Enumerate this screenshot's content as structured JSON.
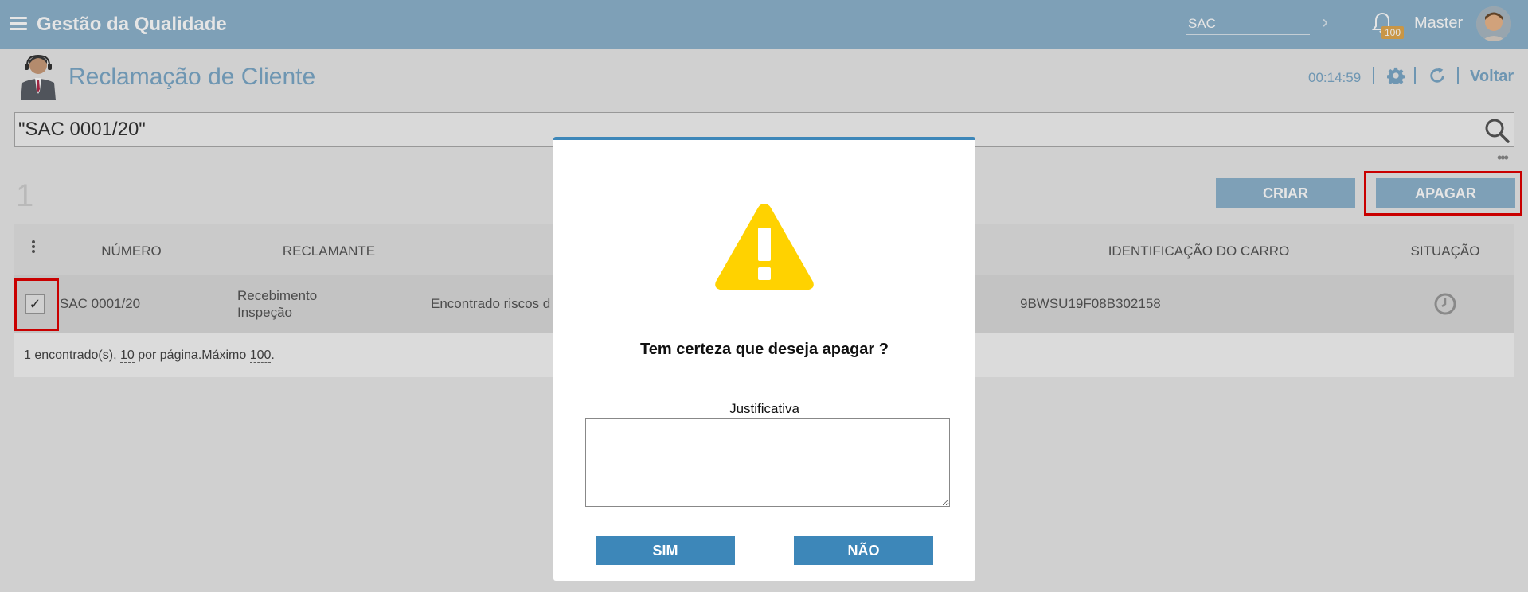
{
  "topbar": {
    "app_title": "Gestão da Qualidade",
    "sac_value": "SAC",
    "badge": "100",
    "user": "Master"
  },
  "header": {
    "title": "Reclamação de Cliente",
    "timer": "00:14:59",
    "voltar": "Voltar"
  },
  "search": {
    "value": "\"SAC 0001/20\""
  },
  "list": {
    "count": "1",
    "criar": "CRIAR",
    "apagar": "APAGAR",
    "columns": {
      "numero": "NÚMERO",
      "reclamante": "RECLAMANTE",
      "identificacao": "IDENTIFICAÇÃO DO CARRO",
      "situacao": "SITUAÇÃO"
    },
    "row": {
      "check": "✓",
      "numero": "SAC 0001/20",
      "reclamante_1": "Recebimento",
      "reclamante_2": "Inspeção",
      "descricao": "Encontrado riscos d",
      "identificacao": "9BWSU19F08B302158"
    },
    "footer": {
      "found": "1 encontrado(s), ",
      "per_page": "10",
      "per_page_label": " por página.Máximo ",
      "max": "100",
      "end": "."
    }
  },
  "dialog": {
    "question": "Tem certeza que deseja apagar ?",
    "justificativa_label": "Justificativa",
    "justificativa_value": "",
    "sim": "SIM",
    "nao": "NÃO"
  },
  "colors": {
    "topbar": "#8db3cc",
    "accent": "#3d87b9",
    "warning": "#ffd200",
    "highlight": "#e00000"
  }
}
